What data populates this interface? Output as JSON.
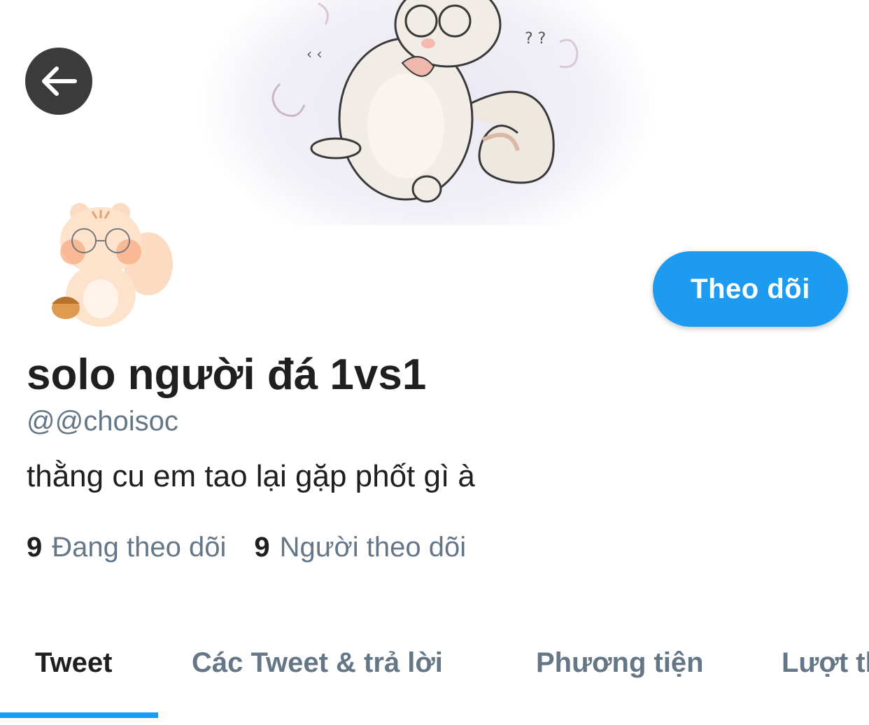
{
  "profile": {
    "display_name": "solo người đá 1vs1",
    "handle": "@@choisoc",
    "bio": "thằng cu em tao lại gặp phốt gì à"
  },
  "actions": {
    "follow_label": "Theo dõi",
    "back_icon": "arrow-left-icon"
  },
  "stats": {
    "following_count": "9",
    "following_label": "Đang theo dõi",
    "followers_count": "9",
    "followers_label": "Người theo dõi"
  },
  "tabs": [
    {
      "label": "Tweet",
      "active": true
    },
    {
      "label": "Các Tweet & trả lời",
      "active": false
    },
    {
      "label": "Phương tiện",
      "active": false
    },
    {
      "label": "Lượt thích",
      "active": false
    }
  ],
  "colors": {
    "accent": "#1d9bf0",
    "secondary_text": "#657786",
    "back_button": "#3b3b3c"
  }
}
